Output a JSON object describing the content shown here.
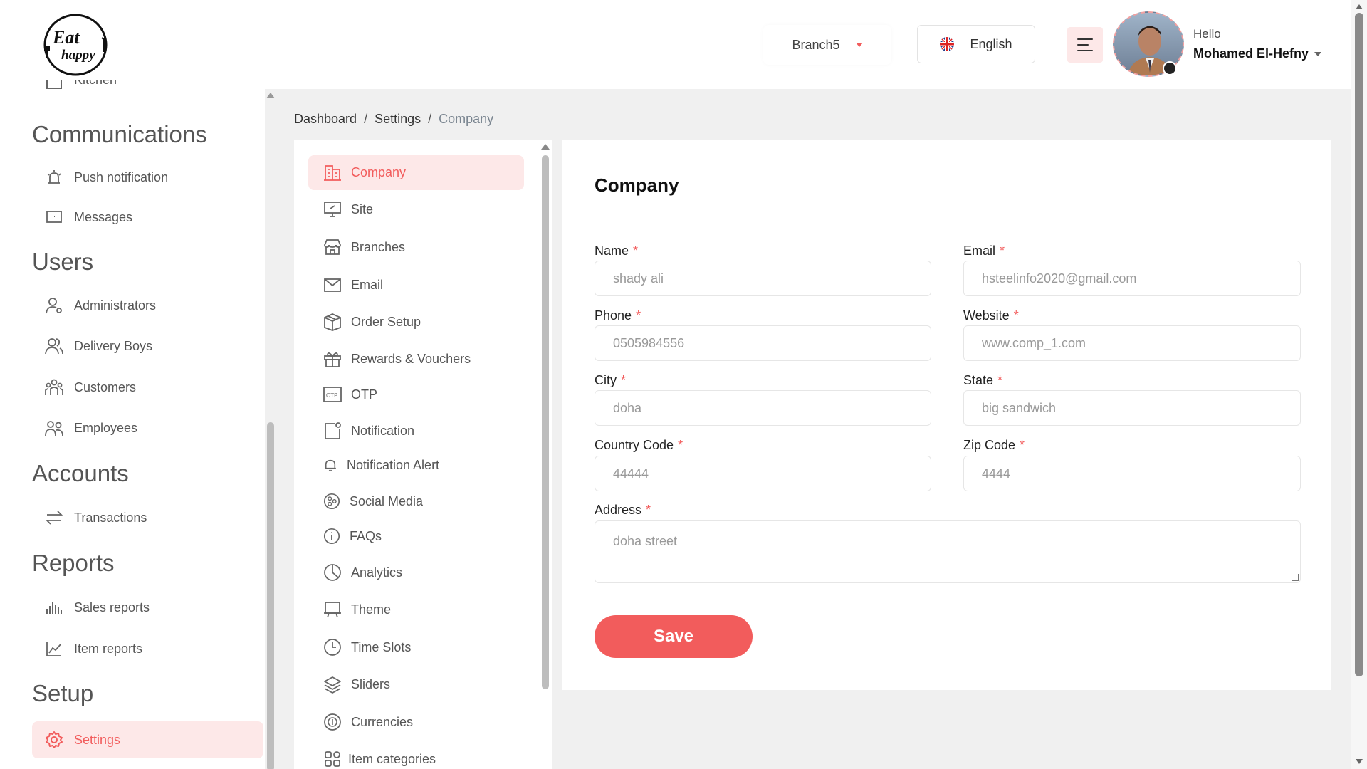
{
  "brand": {
    "logo_line1": "Eat",
    "logo_line2": "happy",
    "accent": "#f25c5c",
    "accent_soft": "#fde8e8"
  },
  "header": {
    "branch": "Branch5",
    "language": "English",
    "greeting": "Hello",
    "user_name": "Mohamed El-Hefny"
  },
  "sidebar": {
    "partial_item": "Kitchen",
    "sections": {
      "communications": "Communications",
      "users": "Users",
      "accounts": "Accounts",
      "reports": "Reports",
      "setup": "Setup"
    },
    "items": {
      "push_notification": "Push notification",
      "messages": "Messages",
      "administrators": "Administrators",
      "delivery_boys": "Delivery Boys",
      "customers": "Customers",
      "employees": "Employees",
      "transactions": "Transactions",
      "sales_reports": "Sales reports",
      "item_reports": "Item reports",
      "settings": "Settings"
    }
  },
  "breadcrumb": {
    "home": "Dashboard",
    "parent": "Settings",
    "current": "Company",
    "separator": "/"
  },
  "settings_menu": [
    {
      "label": "Company",
      "icon": "building-icon"
    },
    {
      "label": "Site",
      "icon": "monitor-icon"
    },
    {
      "label": "Branches",
      "icon": "store-icon"
    },
    {
      "label": "Email",
      "icon": "mail-icon"
    },
    {
      "label": "Order Setup",
      "icon": "box-icon"
    },
    {
      "label": "Rewards & Vouchers",
      "icon": "gift-icon"
    },
    {
      "label": "OTP",
      "icon": "otp-icon"
    },
    {
      "label": "Notification",
      "icon": "notification-square-icon"
    },
    {
      "label": "Notification Alert",
      "icon": "bell-icon"
    },
    {
      "label": "Social Media",
      "icon": "share-icon"
    },
    {
      "label": "FAQs",
      "icon": "info-icon"
    },
    {
      "label": "Analytics",
      "icon": "pie-chart-icon"
    },
    {
      "label": "Theme",
      "icon": "easel-icon"
    },
    {
      "label": "Time Slots",
      "icon": "clock-icon"
    },
    {
      "label": "Sliders",
      "icon": "layers-icon"
    },
    {
      "label": "Currencies",
      "icon": "coin-icon"
    },
    {
      "label": "Item categories",
      "icon": "grid-icon"
    }
  ],
  "form": {
    "title": "Company",
    "fields": {
      "name": {
        "label": "Name",
        "value": "shady ali"
      },
      "email": {
        "label": "Email",
        "value": "hsteelinfo2020@gmail.com"
      },
      "phone": {
        "label": "Phone",
        "value": "0505984556"
      },
      "website": {
        "label": "Website",
        "value": "www.comp_1.com"
      },
      "city": {
        "label": "City",
        "value": "doha"
      },
      "state": {
        "label": "State",
        "value": "big sandwich"
      },
      "country_code": {
        "label": "Country Code",
        "value": "44444"
      },
      "zip_code": {
        "label": "Zip Code",
        "value": "4444"
      },
      "address": {
        "label": "Address",
        "value": "doha street"
      }
    },
    "required_mark": "*",
    "save_label": "Save"
  }
}
